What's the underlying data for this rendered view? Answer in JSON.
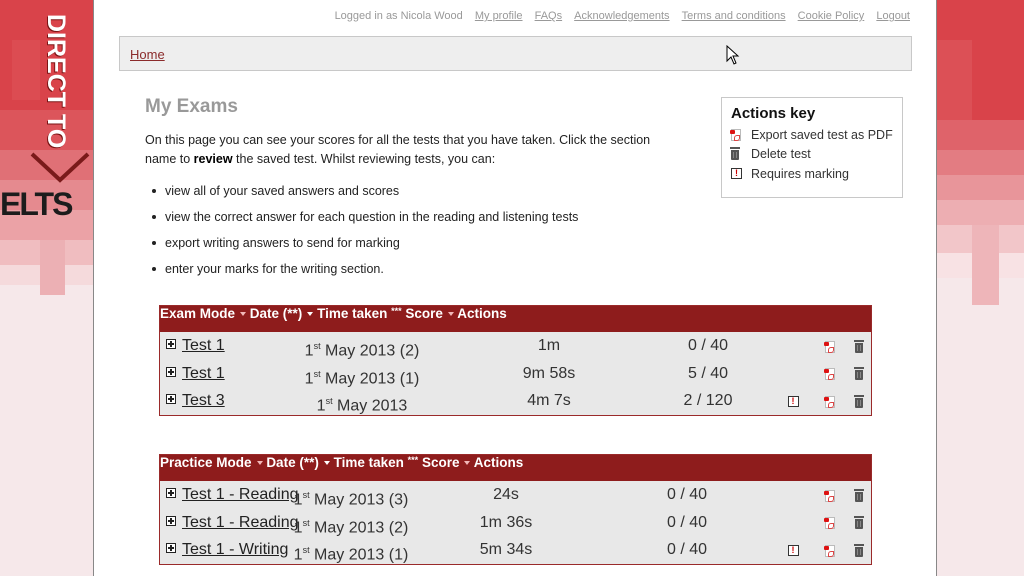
{
  "brand": {
    "line1": "DIRECT TO",
    "line2": "ELTS",
    "colors": {
      "red": "#d93a40",
      "pink": "#f6e8ea",
      "maroon": "#8e1c1c"
    }
  },
  "topnav": {
    "logged_in": "Logged in as Nicola Wood",
    "links": [
      "My profile",
      "FAQs",
      "Acknowledgements",
      "Terms and conditions",
      "Cookie Policy",
      "Logout"
    ]
  },
  "breadcrumb": {
    "home": "Home"
  },
  "page": {
    "title": "My Exams",
    "intro_before": "On this page you can see your scores for all the tests that you have taken. Click the section name to ",
    "intro_bold": "review",
    "intro_after": " the saved test. Whilst reviewing tests, you can:",
    "bullets": [
      "view all of your saved answers and scores",
      "view the correct answer for each question in the reading and listening tests",
      "export writing answers to send for marking",
      "enter your marks for the writing section."
    ]
  },
  "actions_key": {
    "title": "Actions key",
    "items": [
      {
        "icon": "pdf-icon",
        "label": "Export saved test as PDF"
      },
      {
        "icon": "trash-icon",
        "label": "Delete test"
      },
      {
        "icon": "requires-marking-icon",
        "label": "Requires marking"
      }
    ]
  },
  "exam_table": {
    "headers": {
      "mode": "Exam Mode",
      "date": "Date (**)",
      "time": "Time taken",
      "time_stars": "***",
      "score": "Score",
      "actions": "Actions"
    },
    "rows": [
      {
        "name": "Test 1",
        "day": "1",
        "suffix": "st",
        "date": " May 2013 (2)",
        "time": "1m",
        "score": "0 / 40",
        "requires_marking": false
      },
      {
        "name": "Test 1",
        "day": "1",
        "suffix": "st",
        "date": " May 2013 (1)",
        "time": "9m 58s",
        "score": "5 / 40",
        "requires_marking": false
      },
      {
        "name": "Test 3",
        "day": "1",
        "suffix": "st",
        "date": " May 2013",
        "time": "4m 7s",
        "score": "2 / 120",
        "requires_marking": true
      }
    ]
  },
  "practice_table": {
    "headers": {
      "mode": "Practice Mode",
      "date": "Date (**)",
      "time": "Time taken",
      "time_stars": "***",
      "score": "Score",
      "actions": "Actions"
    },
    "rows": [
      {
        "name": "Test 1 - Reading",
        "day": "1",
        "suffix": "st",
        "date": " May 2013 (3)",
        "time": "24s",
        "score": "0 / 40",
        "requires_marking": false
      },
      {
        "name": "Test 1 - Reading",
        "day": "1",
        "suffix": "st",
        "date": " May 2013 (2)",
        "time": "1m 36s",
        "score": "0 / 40",
        "requires_marking": false
      },
      {
        "name": "Test 1 - Writing",
        "day": "1",
        "suffix": "st",
        "date": " May 2013 (1)",
        "time": "5m 34s",
        "score": "0 / 40",
        "requires_marking": true
      }
    ]
  }
}
